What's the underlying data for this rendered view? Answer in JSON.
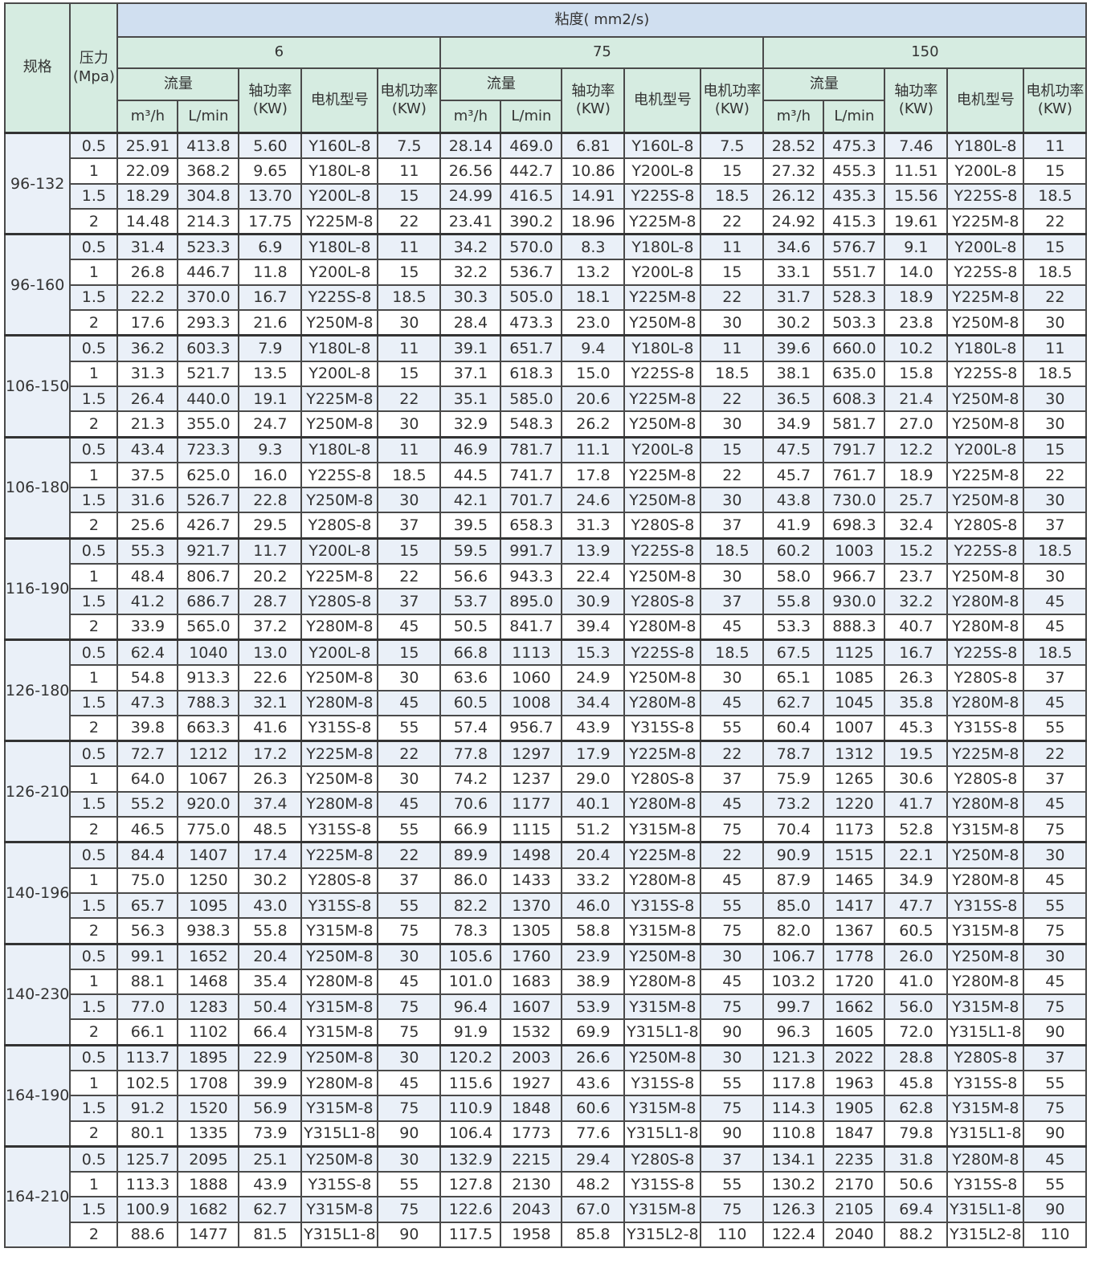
{
  "headers": {
    "model": "规格",
    "pressure": "压力(Mpa)",
    "viscosity": "粘度( mm2/s)",
    "viscosity_values": [
      "6",
      "75",
      "150"
    ],
    "flow": "流量",
    "shaft_power": "轴功率(KW)",
    "motor_type": "电机型号",
    "motor_power": "电机功率(KW)",
    "unit_m3h": "m³/h",
    "unit_lmin": "L/min"
  },
  "groups": [
    {
      "model": "96-132",
      "rows": [
        [
          "0.5",
          "25.91",
          "413.8",
          "5.60",
          "Y160L-8",
          "7.5",
          "28.14",
          "469.0",
          "6.81",
          "Y160L-8",
          "7.5",
          "28.52",
          "475.3",
          "7.46",
          "Y180L-8",
          "11"
        ],
        [
          "1",
          "22.09",
          "368.2",
          "9.65",
          "Y180L-8",
          "11",
          "26.56",
          "442.7",
          "10.86",
          "Y200L-8",
          "15",
          "27.32",
          "455.3",
          "11.51",
          "Y200L-8",
          "15"
        ],
        [
          "1.5",
          "18.29",
          "304.8",
          "13.70",
          "Y200L-8",
          "15",
          "24.99",
          "416.5",
          "14.91",
          "Y225S-8",
          "18.5",
          "26.12",
          "435.3",
          "15.56",
          "Y225S-8",
          "18.5"
        ],
        [
          "2",
          "14.48",
          "214.3",
          "17.75",
          "Y225M-8",
          "22",
          "23.41",
          "390.2",
          "18.96",
          "Y225M-8",
          "22",
          "24.92",
          "415.3",
          "19.61",
          "Y225M-8",
          "22"
        ]
      ]
    },
    {
      "model": "96-160",
      "rows": [
        [
          "0.5",
          "31.4",
          "523.3",
          "6.9",
          "Y180L-8",
          "11",
          "34.2",
          "570.0",
          "8.3",
          "Y180L-8",
          "11",
          "34.6",
          "576.7",
          "9.1",
          "Y200L-8",
          "15"
        ],
        [
          "1",
          "26.8",
          "446.7",
          "11.8",
          "Y200L-8",
          "15",
          "32.2",
          "536.7",
          "13.2",
          "Y200L-8",
          "15",
          "33.1",
          "551.7",
          "14.0",
          "Y225S-8",
          "18.5"
        ],
        [
          "1.5",
          "22.2",
          "370.0",
          "16.7",
          "Y225S-8",
          "18.5",
          "30.3",
          "505.0",
          "18.1",
          "Y225M-8",
          "22",
          "31.7",
          "528.3",
          "18.9",
          "Y225M-8",
          "22"
        ],
        [
          "2",
          "17.6",
          "293.3",
          "21.6",
          "Y250M-8",
          "30",
          "28.4",
          "473.3",
          "23.0",
          "Y250M-8",
          "30",
          "30.2",
          "503.3",
          "23.8",
          "Y250M-8",
          "30"
        ]
      ]
    },
    {
      "model": "106-150",
      "rows": [
        [
          "0.5",
          "36.2",
          "603.3",
          "7.9",
          "Y180L-8",
          "11",
          "39.1",
          "651.7",
          "9.4",
          "Y180L-8",
          "11",
          "39.6",
          "660.0",
          "10.2",
          "Y180L-8",
          "11"
        ],
        [
          "1",
          "31.3",
          "521.7",
          "13.5",
          "Y200L-8",
          "15",
          "37.1",
          "618.3",
          "15.0",
          "Y225S-8",
          "18.5",
          "38.1",
          "635.0",
          "15.8",
          "Y225S-8",
          "18.5"
        ],
        [
          "1.5",
          "26.4",
          "440.0",
          "19.1",
          "Y225M-8",
          "22",
          "35.1",
          "585.0",
          "20.6",
          "Y225M-8",
          "22",
          "36.5",
          "608.3",
          "21.4",
          "Y250M-8",
          "30"
        ],
        [
          "2",
          "21.3",
          "355.0",
          "24.7",
          "Y250M-8",
          "30",
          "32.9",
          "548.3",
          "26.2",
          "Y250M-8",
          "30",
          "34.9",
          "581.7",
          "27.0",
          "Y250M-8",
          "30"
        ]
      ]
    },
    {
      "model": "106-180",
      "rows": [
        [
          "0.5",
          "43.4",
          "723.3",
          "9.3",
          "Y180L-8",
          "11",
          "46.9",
          "781.7",
          "11.1",
          "Y200L-8",
          "15",
          "47.5",
          "791.7",
          "12.2",
          "Y200L-8",
          "15"
        ],
        [
          "1",
          "37.5",
          "625.0",
          "16.0",
          "Y225S-8",
          "18.5",
          "44.5",
          "741.7",
          "17.8",
          "Y225M-8",
          "22",
          "45.7",
          "761.7",
          "18.9",
          "Y225M-8",
          "22"
        ],
        [
          "1.5",
          "31.6",
          "526.7",
          "22.8",
          "Y250M-8",
          "30",
          "42.1",
          "701.7",
          "24.6",
          "Y250M-8",
          "30",
          "43.8",
          "730.0",
          "25.7",
          "Y250M-8",
          "30"
        ],
        [
          "2",
          "25.6",
          "426.7",
          "29.5",
          "Y280S-8",
          "37",
          "39.5",
          "658.3",
          "31.3",
          "Y280S-8",
          "37",
          "41.9",
          "698.3",
          "32.4",
          "Y280S-8",
          "37"
        ]
      ]
    },
    {
      "model": "116-190",
      "rows": [
        [
          "0.5",
          "55.3",
          "921.7",
          "11.7",
          "Y200L-8",
          "15",
          "59.5",
          "991.7",
          "13.9",
          "Y225S-8",
          "18.5",
          "60.2",
          "1003",
          "15.2",
          "Y225S-8",
          "18.5"
        ],
        [
          "1",
          "48.4",
          "806.7",
          "20.2",
          "Y225M-8",
          "22",
          "56.6",
          "943.3",
          "22.4",
          "Y250M-8",
          "30",
          "58.0",
          "966.7",
          "23.7",
          "Y250M-8",
          "30"
        ],
        [
          "1.5",
          "41.2",
          "686.7",
          "28.7",
          "Y280S-8",
          "37",
          "53.7",
          "895.0",
          "30.9",
          "Y280S-8",
          "37",
          "55.8",
          "930.0",
          "32.2",
          "Y280M-8",
          "45"
        ],
        [
          "2",
          "33.9",
          "565.0",
          "37.2",
          "Y280M-8",
          "45",
          "50.5",
          "841.7",
          "39.4",
          "Y280M-8",
          "45",
          "53.3",
          "888.3",
          "40.7",
          "Y280M-8",
          "45"
        ]
      ]
    },
    {
      "model": "126-180",
      "rows": [
        [
          "0.5",
          "62.4",
          "1040",
          "13.0",
          "Y200L-8",
          "15",
          "66.8",
          "1113",
          "15.3",
          "Y225S-8",
          "18.5",
          "67.5",
          "1125",
          "16.7",
          "Y225S-8",
          "18.5"
        ],
        [
          "1",
          "54.8",
          "913.3",
          "22.6",
          "Y250M-8",
          "30",
          "63.6",
          "1060",
          "24.9",
          "Y250M-8",
          "30",
          "65.1",
          "1085",
          "26.3",
          "Y280S-8",
          "37"
        ],
        [
          "1.5",
          "47.3",
          "788.3",
          "32.1",
          "Y280M-8",
          "45",
          "60.5",
          "1008",
          "34.4",
          "Y280M-8",
          "45",
          "62.7",
          "1045",
          "35.8",
          "Y280M-8",
          "45"
        ],
        [
          "2",
          "39.8",
          "663.3",
          "41.6",
          "Y315S-8",
          "55",
          "57.4",
          "956.7",
          "43.9",
          "Y315S-8",
          "55",
          "60.4",
          "1007",
          "45.3",
          "Y315S-8",
          "55"
        ]
      ]
    },
    {
      "model": "126-210",
      "rows": [
        [
          "0.5",
          "72.7",
          "1212",
          "17.2",
          "Y225M-8",
          "22",
          "77.8",
          "1297",
          "17.9",
          "Y225M-8",
          "22",
          "78.7",
          "1312",
          "19.5",
          "Y225M-8",
          "22"
        ],
        [
          "1",
          "64.0",
          "1067",
          "26.3",
          "Y250M-8",
          "30",
          "74.2",
          "1237",
          "29.0",
          "Y280S-8",
          "37",
          "75.9",
          "1265",
          "30.6",
          "Y280S-8",
          "37"
        ],
        [
          "1.5",
          "55.2",
          "920.0",
          "37.4",
          "Y280M-8",
          "45",
          "70.6",
          "1177",
          "40.1",
          "Y280M-8",
          "45",
          "73.2",
          "1220",
          "41.7",
          "Y280M-8",
          "45"
        ],
        [
          "2",
          "46.5",
          "775.0",
          "48.5",
          "Y315S-8",
          "55",
          "66.9",
          "1115",
          "51.2",
          "Y315M-8",
          "75",
          "70.4",
          "1173",
          "52.8",
          "Y315M-8",
          "75"
        ]
      ]
    },
    {
      "model": "140-196",
      "rows": [
        [
          "0.5",
          "84.4",
          "1407",
          "17.4",
          "Y225M-8",
          "22",
          "89.9",
          "1498",
          "20.4",
          "Y225M-8",
          "22",
          "90.9",
          "1515",
          "22.1",
          "Y250M-8",
          "30"
        ],
        [
          "1",
          "75.0",
          "1250",
          "30.2",
          "Y280S-8",
          "37",
          "86.0",
          "1433",
          "33.2",
          "Y280M-8",
          "45",
          "87.9",
          "1465",
          "34.9",
          "Y280M-8",
          "45"
        ],
        [
          "1.5",
          "65.7",
          "1095",
          "43.0",
          "Y315S-8",
          "55",
          "82.2",
          "1370",
          "46.0",
          "Y315S-8",
          "55",
          "85.0",
          "1417",
          "47.7",
          "Y315S-8",
          "55"
        ],
        [
          "2",
          "56.3",
          "938.3",
          "55.8",
          "Y315M-8",
          "75",
          "78.3",
          "1305",
          "58.8",
          "Y315M-8",
          "75",
          "82.0",
          "1367",
          "60.5",
          "Y315M-8",
          "75"
        ]
      ]
    },
    {
      "model": "140-230",
      "rows": [
        [
          "0.5",
          "99.1",
          "1652",
          "20.4",
          "Y250M-8",
          "30",
          "105.6",
          "1760",
          "23.9",
          "Y250M-8",
          "30",
          "106.7",
          "1778",
          "26.0",
          "Y250M-8",
          "30"
        ],
        [
          "1",
          "88.1",
          "1468",
          "35.4",
          "Y280M-8",
          "45",
          "101.0",
          "1683",
          "38.9",
          "Y280M-8",
          "45",
          "103.2",
          "1720",
          "41.0",
          "Y280M-8",
          "45"
        ],
        [
          "1.5",
          "77.0",
          "1283",
          "50.4",
          "Y315M-8",
          "75",
          "96.4",
          "1607",
          "53.9",
          "Y315M-8",
          "75",
          "99.7",
          "1662",
          "56.0",
          "Y315M-8",
          "75"
        ],
        [
          "2",
          "66.1",
          "1102",
          "66.4",
          "Y315M-8",
          "75",
          "91.9",
          "1532",
          "69.9",
          "Y315L1-8",
          "90",
          "96.3",
          "1605",
          "72.0",
          "Y315L1-8",
          "90"
        ]
      ]
    },
    {
      "model": "164-190",
      "rows": [
        [
          "0.5",
          "113.7",
          "1895",
          "22.9",
          "Y250M-8",
          "30",
          "120.2",
          "2003",
          "26.6",
          "Y250M-8",
          "30",
          "121.3",
          "2022",
          "28.8",
          "Y280S-8",
          "37"
        ],
        [
          "1",
          "102.5",
          "1708",
          "39.9",
          "Y280M-8",
          "45",
          "115.6",
          "1927",
          "43.6",
          "Y315S-8",
          "55",
          "117.8",
          "1963",
          "45.8",
          "Y315S-8",
          "55"
        ],
        [
          "1.5",
          "91.2",
          "1520",
          "56.9",
          "Y315M-8",
          "75",
          "110.9",
          "1848",
          "60.6",
          "Y315M-8",
          "75",
          "114.3",
          "1905",
          "62.8",
          "Y315M-8",
          "75"
        ],
        [
          "2",
          "80.1",
          "1335",
          "73.9",
          "Y315L1-8",
          "90",
          "106.4",
          "1773",
          "77.6",
          "Y315L1-8",
          "90",
          "110.8",
          "1847",
          "79.8",
          "Y315L1-8",
          "90"
        ]
      ]
    },
    {
      "model": "164-210",
      "rows": [
        [
          "0.5",
          "125.7",
          "2095",
          "25.1",
          "Y250M-8",
          "30",
          "132.9",
          "2215",
          "29.4",
          "Y280S-8",
          "37",
          "134.1",
          "2235",
          "31.8",
          "Y280M-8",
          "45"
        ],
        [
          "1",
          "113.3",
          "1888",
          "43.9",
          "Y315S-8",
          "55",
          "127.8",
          "2130",
          "48.2",
          "Y315S-8",
          "55",
          "130.2",
          "2170",
          "50.6",
          "Y315S-8",
          "55"
        ],
        [
          "1.5",
          "100.9",
          "1682",
          "62.7",
          "Y315M-8",
          "75",
          "122.6",
          "2043",
          "67.0",
          "Y315M-8",
          "75",
          "126.3",
          "2105",
          "69.4",
          "Y315L1-8",
          "90"
        ],
        [
          "2",
          "88.6",
          "1477",
          "81.5",
          "Y315L1-8",
          "90",
          "117.5",
          "1958",
          "85.8",
          "Y315L2-8",
          "110",
          "122.4",
          "2040",
          "88.2",
          "Y315L2-8",
          "110"
        ]
      ]
    }
  ]
}
